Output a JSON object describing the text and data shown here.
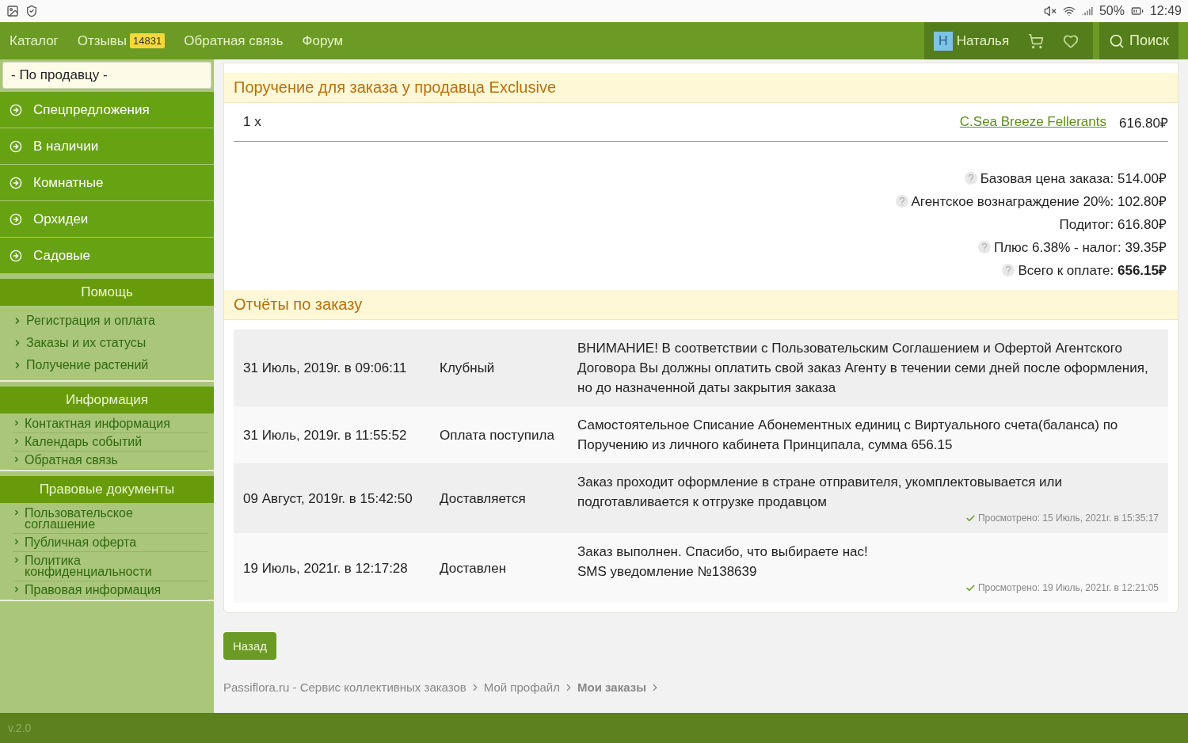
{
  "status_bar": {
    "battery": "50%",
    "time": "12:49"
  },
  "nav": {
    "items": [
      {
        "label": "Каталог"
      },
      {
        "label": "Отзывы",
        "badge": "14831"
      },
      {
        "label": "Обратная связь"
      },
      {
        "label": "Форум"
      }
    ],
    "user": {
      "initial": "Н",
      "name": "Наталья"
    },
    "search": "Поиск"
  },
  "sidebar": {
    "filter": "- По продавцу -",
    "categories": [
      {
        "label": "Спецпредложения"
      },
      {
        "label": "В наличии"
      },
      {
        "label": "Комнатные"
      },
      {
        "label": "Орхидеи"
      },
      {
        "label": "Садовые"
      }
    ],
    "sections": [
      {
        "title": "Помощь",
        "kind": "plain",
        "links": [
          "Регистрация и оплата",
          "Заказы и их статусы",
          "Получение растений"
        ]
      },
      {
        "title": "Информация",
        "kind": "ruled",
        "links": [
          "Контактная информация",
          "Календарь событий",
          "Обратная связь"
        ]
      },
      {
        "title": "Правовые документы",
        "kind": "ruled",
        "links": [
          "Пользовательское соглашение",
          "Публичная оферта",
          "Политика конфиденциальности",
          "Правовая информация"
        ]
      }
    ],
    "version": "v.2.0"
  },
  "order": {
    "title": "Поручение для заказа у продавца Exclusive",
    "item": {
      "qty": "1 x",
      "name": "C.Sea Breeze Fellerants",
      "price": "616.80₽"
    },
    "totals": [
      {
        "text": "Базовая цена заказа: 514.00₽",
        "help": true
      },
      {
        "text": "Агентское вознаграждение 20%: 102.80₽",
        "help": true
      },
      {
        "text": "Подитог: 616.80₽",
        "help": false
      },
      {
        "text": "Плюс 6.38% - налог: 39.35₽",
        "help": true
      },
      {
        "text": "Всего к оплате: **656.15₽**",
        "help": true
      }
    ]
  },
  "reports": {
    "title": "Отчёты по заказу",
    "rows": [
      {
        "date": "31 Июль, 2019г. в 09:06:11",
        "status": "Клубный",
        "message": "ВНИМАНИЕ! В соответствии с Пользовательским Соглашением и Офертой Агентского Договора Вы должны оплатить свой заказ Агенту в течении семи дней после оформления, но до назначенной даты закрытия заказа"
      },
      {
        "date": "31 Июль, 2019г. в 11:55:52",
        "status": "Оплата поступила",
        "message": "Самостоятельное Списание Абонементных единиц с Виртуального счета(баланса) по Поручению из личного кабинета Принципала, сумма 656.15"
      },
      {
        "date": "09 Август, 2019г. в 15:42:50",
        "status": "Доставляется",
        "message": "Заказ проходит оформление в стране отправителя, укомплектовывается или подготавливается к отгрузке продавцом",
        "viewed": "Просмотрено: 15 Июль, 2021г. в 15:35:17"
      },
      {
        "date": "19 Июль, 2021г. в 12:17:28",
        "status": "Доставлен",
        "message": "Заказ выполнен. Спасибо, что выбираете нас!\nSMS уведомление №138639",
        "viewed": "Просмотрено: 19 Июль, 2021г. в 12:21:05"
      }
    ]
  },
  "back_button": "Назад",
  "breadcrumbs": [
    {
      "label": "Passiflora.ru - Сервис коллективных заказов",
      "current": false
    },
    {
      "label": "Мой профайл",
      "current": false
    },
    {
      "label": "Мои заказы",
      "current": true
    }
  ]
}
